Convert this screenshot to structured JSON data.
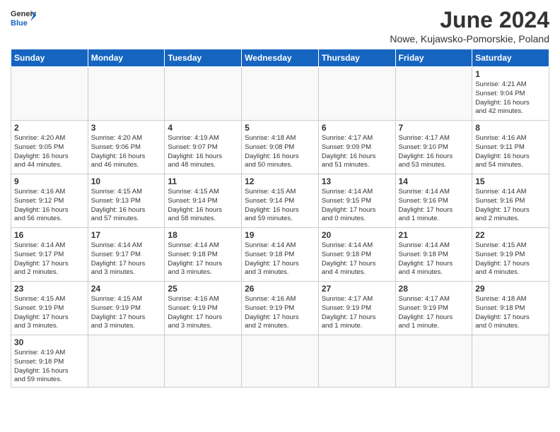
{
  "header": {
    "logo_general": "General",
    "logo_blue": "Blue",
    "month_title": "June 2024",
    "subtitle": "Nowe, Kujawsko-Pomorskie, Poland"
  },
  "weekdays": [
    "Sunday",
    "Monday",
    "Tuesday",
    "Wednesday",
    "Thursday",
    "Friday",
    "Saturday"
  ],
  "weeks": [
    [
      {
        "day": "",
        "info": ""
      },
      {
        "day": "",
        "info": ""
      },
      {
        "day": "",
        "info": ""
      },
      {
        "day": "",
        "info": ""
      },
      {
        "day": "",
        "info": ""
      },
      {
        "day": "",
        "info": ""
      },
      {
        "day": "1",
        "info": "Sunrise: 4:21 AM\nSunset: 9:04 PM\nDaylight: 16 hours\nand 42 minutes."
      }
    ],
    [
      {
        "day": "2",
        "info": "Sunrise: 4:20 AM\nSunset: 9:05 PM\nDaylight: 16 hours\nand 44 minutes."
      },
      {
        "day": "3",
        "info": "Sunrise: 4:20 AM\nSunset: 9:06 PM\nDaylight: 16 hours\nand 46 minutes."
      },
      {
        "day": "4",
        "info": "Sunrise: 4:19 AM\nSunset: 9:07 PM\nDaylight: 16 hours\nand 48 minutes."
      },
      {
        "day": "5",
        "info": "Sunrise: 4:18 AM\nSunset: 9:08 PM\nDaylight: 16 hours\nand 50 minutes."
      },
      {
        "day": "6",
        "info": "Sunrise: 4:17 AM\nSunset: 9:09 PM\nDaylight: 16 hours\nand 51 minutes."
      },
      {
        "day": "7",
        "info": "Sunrise: 4:17 AM\nSunset: 9:10 PM\nDaylight: 16 hours\nand 53 minutes."
      },
      {
        "day": "8",
        "info": "Sunrise: 4:16 AM\nSunset: 9:11 PM\nDaylight: 16 hours\nand 54 minutes."
      }
    ],
    [
      {
        "day": "9",
        "info": "Sunrise: 4:16 AM\nSunset: 9:12 PM\nDaylight: 16 hours\nand 56 minutes."
      },
      {
        "day": "10",
        "info": "Sunrise: 4:15 AM\nSunset: 9:13 PM\nDaylight: 16 hours\nand 57 minutes."
      },
      {
        "day": "11",
        "info": "Sunrise: 4:15 AM\nSunset: 9:14 PM\nDaylight: 16 hours\nand 58 minutes."
      },
      {
        "day": "12",
        "info": "Sunrise: 4:15 AM\nSunset: 9:14 PM\nDaylight: 16 hours\nand 59 minutes."
      },
      {
        "day": "13",
        "info": "Sunrise: 4:14 AM\nSunset: 9:15 PM\nDaylight: 17 hours\nand 0 minutes."
      },
      {
        "day": "14",
        "info": "Sunrise: 4:14 AM\nSunset: 9:16 PM\nDaylight: 17 hours\nand 1 minute."
      },
      {
        "day": "15",
        "info": "Sunrise: 4:14 AM\nSunset: 9:16 PM\nDaylight: 17 hours\nand 2 minutes."
      }
    ],
    [
      {
        "day": "16",
        "info": "Sunrise: 4:14 AM\nSunset: 9:17 PM\nDaylight: 17 hours\nand 2 minutes."
      },
      {
        "day": "17",
        "info": "Sunrise: 4:14 AM\nSunset: 9:17 PM\nDaylight: 17 hours\nand 3 minutes."
      },
      {
        "day": "18",
        "info": "Sunrise: 4:14 AM\nSunset: 9:18 PM\nDaylight: 17 hours\nand 3 minutes."
      },
      {
        "day": "19",
        "info": "Sunrise: 4:14 AM\nSunset: 9:18 PM\nDaylight: 17 hours\nand 3 minutes."
      },
      {
        "day": "20",
        "info": "Sunrise: 4:14 AM\nSunset: 9:18 PM\nDaylight: 17 hours\nand 4 minutes."
      },
      {
        "day": "21",
        "info": "Sunrise: 4:14 AM\nSunset: 9:18 PM\nDaylight: 17 hours\nand 4 minutes."
      },
      {
        "day": "22",
        "info": "Sunrise: 4:15 AM\nSunset: 9:19 PM\nDaylight: 17 hours\nand 4 minutes."
      }
    ],
    [
      {
        "day": "23",
        "info": "Sunrise: 4:15 AM\nSunset: 9:19 PM\nDaylight: 17 hours\nand 3 minutes."
      },
      {
        "day": "24",
        "info": "Sunrise: 4:15 AM\nSunset: 9:19 PM\nDaylight: 17 hours\nand 3 minutes."
      },
      {
        "day": "25",
        "info": "Sunrise: 4:16 AM\nSunset: 9:19 PM\nDaylight: 17 hours\nand 3 minutes."
      },
      {
        "day": "26",
        "info": "Sunrise: 4:16 AM\nSunset: 9:19 PM\nDaylight: 17 hours\nand 2 minutes."
      },
      {
        "day": "27",
        "info": "Sunrise: 4:17 AM\nSunset: 9:19 PM\nDaylight: 17 hours\nand 1 minute."
      },
      {
        "day": "28",
        "info": "Sunrise: 4:17 AM\nSunset: 9:19 PM\nDaylight: 17 hours\nand 1 minute."
      },
      {
        "day": "29",
        "info": "Sunrise: 4:18 AM\nSunset: 9:18 PM\nDaylight: 17 hours\nand 0 minutes."
      }
    ],
    [
      {
        "day": "30",
        "info": "Sunrise: 4:19 AM\nSunset: 9:18 PM\nDaylight: 16 hours\nand 59 minutes."
      },
      {
        "day": "",
        "info": ""
      },
      {
        "day": "",
        "info": ""
      },
      {
        "day": "",
        "info": ""
      },
      {
        "day": "",
        "info": ""
      },
      {
        "day": "",
        "info": ""
      },
      {
        "day": "",
        "info": ""
      }
    ]
  ]
}
